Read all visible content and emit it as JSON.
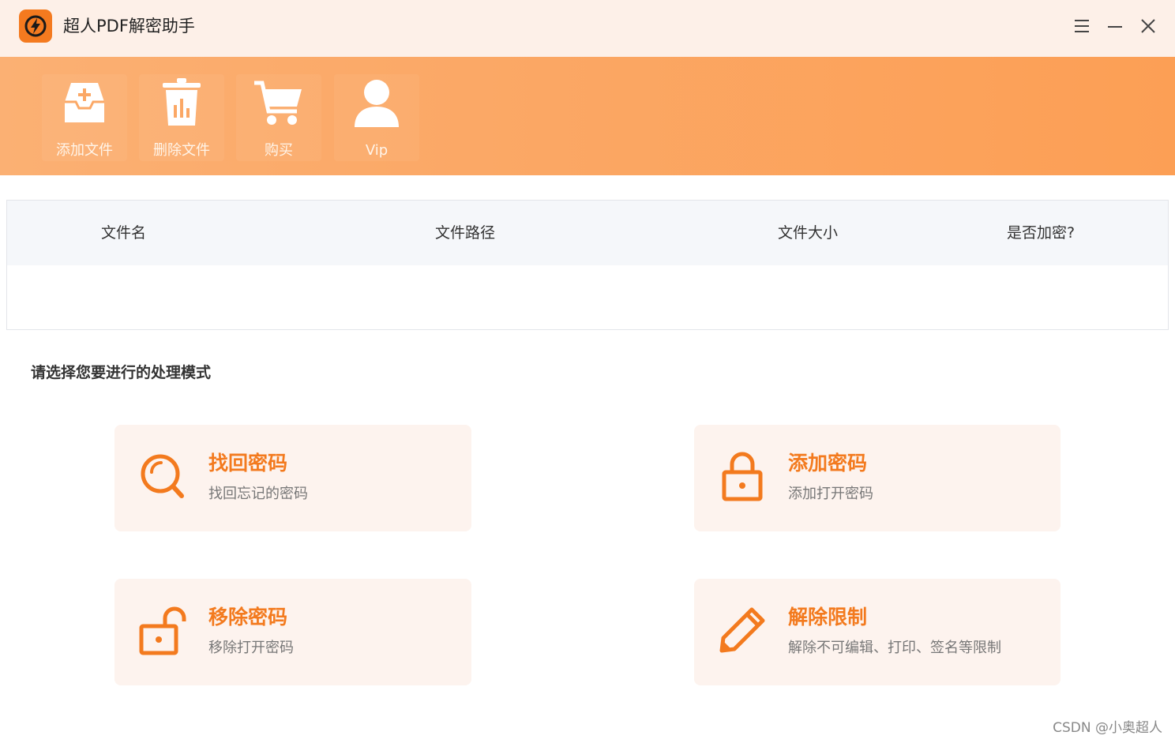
{
  "app": {
    "title": "超人PDF解密助手",
    "logo_icon": "lightning-icon",
    "accent_color": "#f47a1f"
  },
  "window_controls": [
    {
      "name": "menu-icon"
    },
    {
      "name": "minimize-icon"
    },
    {
      "name": "close-icon"
    }
  ],
  "toolbar": {
    "items": [
      {
        "label": "添加文件",
        "icon": "add-file-icon"
      },
      {
        "label": "删除文件",
        "icon": "trash-icon"
      },
      {
        "label": "购买",
        "icon": "cart-icon"
      },
      {
        "label": "Vip",
        "icon": "user-icon"
      }
    ]
  },
  "file_table": {
    "columns": [
      "文件名",
      "文件路径",
      "文件大小",
      "是否加密?"
    ],
    "rows": []
  },
  "modes": {
    "title": "请选择您要进行的处理模式",
    "cards": [
      {
        "title": "找回密码",
        "desc": "找回忘记的密码",
        "icon": "search-icon"
      },
      {
        "title": "添加密码",
        "desc": "添加打开密码",
        "icon": "lock-icon"
      },
      {
        "title": "移除密码",
        "desc": "移除打开密码",
        "icon": "unlock-icon"
      },
      {
        "title": "解除限制",
        "desc": "解除不可编辑、打印、签名等限制",
        "icon": "pencil-icon"
      }
    ]
  },
  "watermark": "CSDN @小奥超人"
}
